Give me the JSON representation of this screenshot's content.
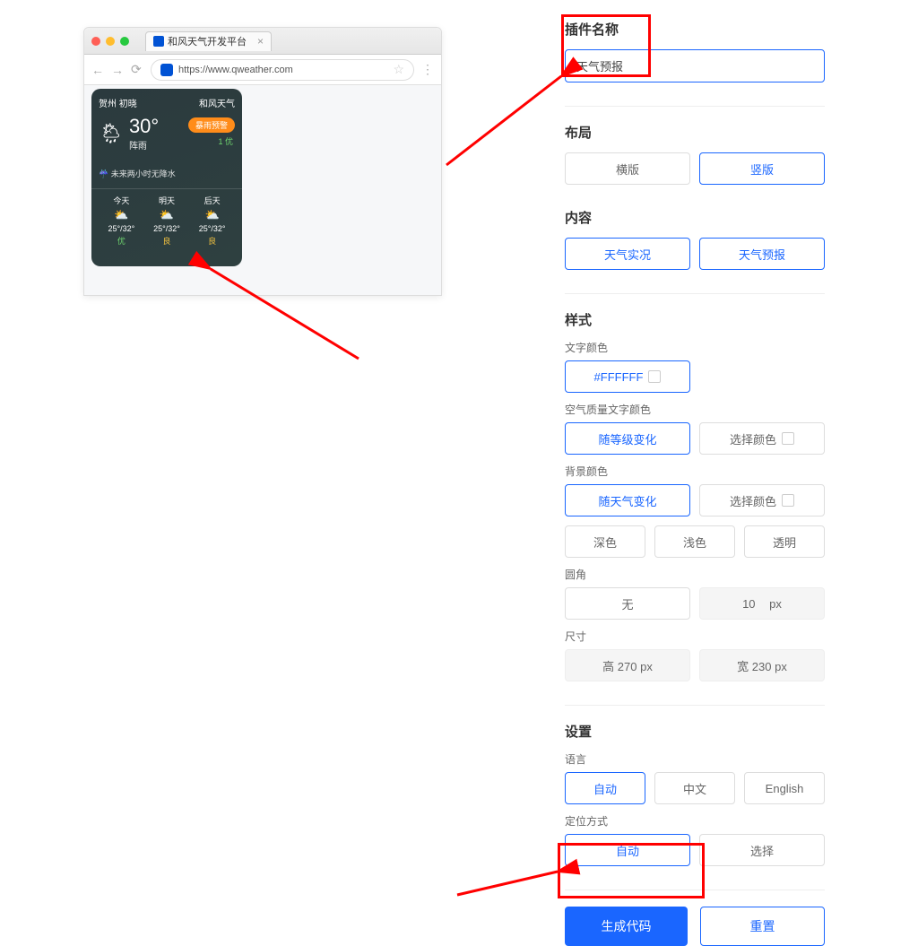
{
  "browser": {
    "tab_title": "和风天气开发平台",
    "url": "https://www.qweather.com"
  },
  "widget": {
    "city": "贺州",
    "period": "初晓",
    "brand": "和风天气",
    "temp": "30°",
    "cond": "阵雨",
    "badge": "暴雨预警",
    "aqi_top": "1 优",
    "rain_hint": "未来两小时无降水",
    "days": [
      {
        "name": "今天",
        "icon": "⛅",
        "range": "25°/32°",
        "aq": "优",
        "aq_cls": "aq-good"
      },
      {
        "name": "明天",
        "icon": "⛅",
        "range": "25°/32°",
        "aq": "良",
        "aq_cls": "aq-mod"
      },
      {
        "name": "后天",
        "icon": "⛅",
        "range": "25°/32°",
        "aq": "良",
        "aq_cls": "aq-mod"
      }
    ]
  },
  "form": {
    "plugin_name_label": "插件名称",
    "plugin_name_value": "天气预报",
    "layout_label": "布局",
    "layout_horizontal": "横版",
    "layout_vertical": "竖版",
    "content_label": "内容",
    "content_now": "天气实况",
    "content_forecast": "天气预报",
    "style_label": "样式",
    "text_color_label": "文字颜色",
    "text_color_value": "#FFFFFF",
    "aqi_color_label": "空气质量文字颜色",
    "aqi_color_auto": "随等级变化",
    "choose_color": "选择颜色",
    "bg_label": "背景颜色",
    "bg_auto": "随天气变化",
    "bg_dark": "深色",
    "bg_light": "浅色",
    "bg_transparent": "透明",
    "radius_label": "圆角",
    "radius_none": "无",
    "radius_val": "10",
    "px": "px",
    "size_label": "尺寸",
    "size_h": "高 270 px",
    "size_w": "宽 230 px",
    "settings_label": "设置",
    "lang_label": "语言",
    "lang_auto": "自动",
    "lang_zh": "中文",
    "lang_en": "English",
    "loc_label": "定位方式",
    "loc_auto": "自动",
    "loc_select": "选择",
    "generate": "生成代码",
    "reset": "重置"
  }
}
